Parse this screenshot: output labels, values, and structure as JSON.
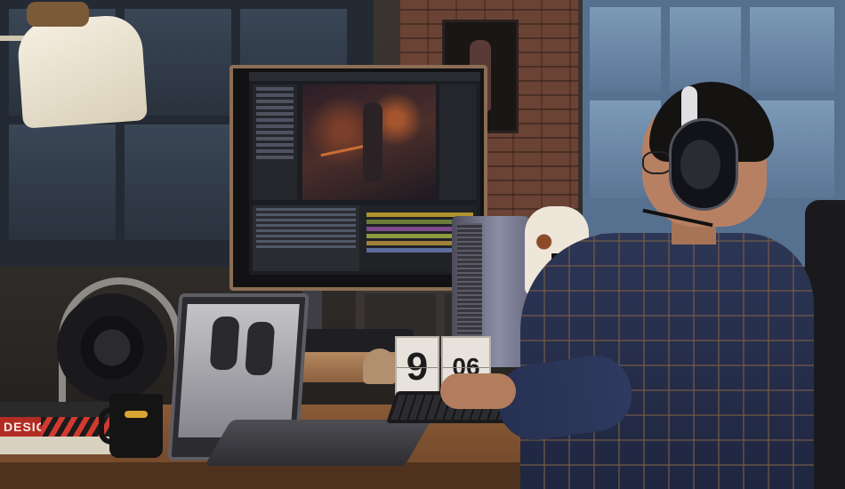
{
  "scene": {
    "description_label": "",
    "book_spine_text": "DESIGN",
    "clock": {
      "hours": "9",
      "minutes": "06"
    },
    "laptop_brand": "",
    "colors": {
      "desk_wood": "#8a5a35",
      "brick": "#6a4334",
      "monitor_bezel": "#8c6d55",
      "shirt_plaid": "#2c3655",
      "book_red": "#b32c24"
    },
    "icons": [
      "monitor-icon",
      "laptop-icon",
      "headphones-icon",
      "speaker-icon",
      "camera-icon",
      "mug-icon",
      "lamp-icon",
      "flip-clock-icon"
    ]
  }
}
